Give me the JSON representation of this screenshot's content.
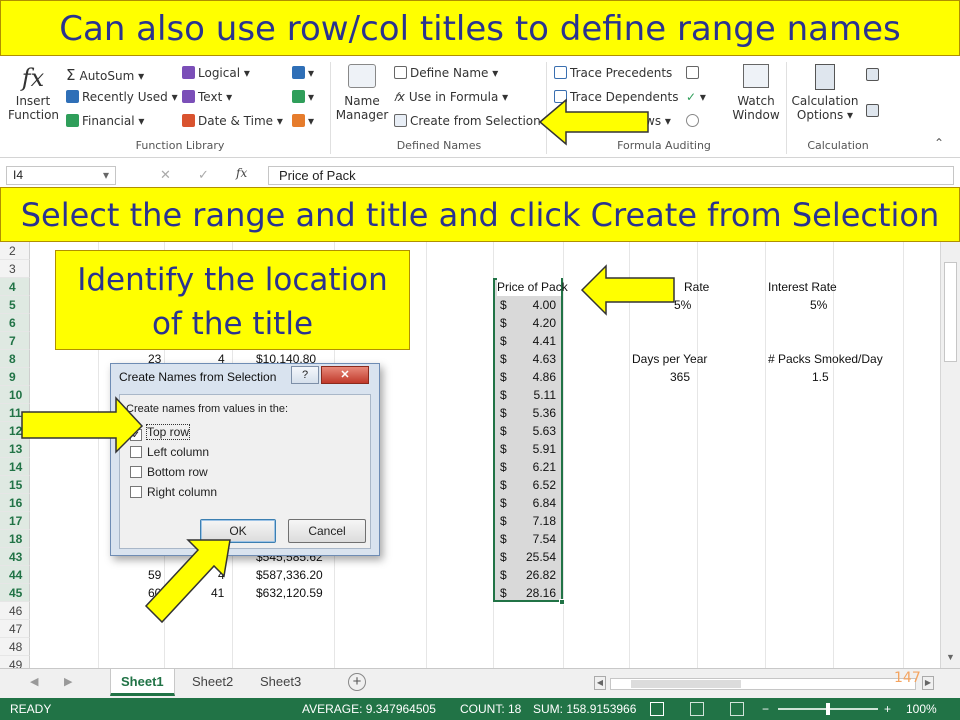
{
  "banners": {
    "top": "Can also use row/col titles to define range names",
    "middle": "Select the range and title and click Create from Selection",
    "callout": [
      "Identify the location",
      "of the title"
    ]
  },
  "ribbon": {
    "insert_function": [
      "Insert",
      "Function"
    ],
    "autosum": "AutoSum",
    "recently_used": "Recently Used",
    "financial": "Financial",
    "logical": "Logical",
    "text": "Text",
    "date_time": "Date & Time",
    "name_manager": [
      "Name",
      "Manager"
    ],
    "define_name": "Define Name",
    "use_in_formula": "Use in Formula",
    "create_from_selection": "Create from Selection",
    "trace_precedents": "Trace Precedents",
    "trace_dependents": "Trace Dependents",
    "remove_arrows_partial": "ws",
    "watch_window": [
      "Watch",
      "Window"
    ],
    "calculation_options": [
      "Calculation",
      "Options"
    ],
    "groups": [
      "Function Library",
      "Defined Names",
      "Formula Auditing",
      "Calculation"
    ]
  },
  "formula_bar": {
    "name_box": "I4",
    "fx": "fx",
    "content": "Price of Pack"
  },
  "grid": {
    "rows": [
      {
        "n": "2"
      },
      {
        "n": "3"
      },
      {
        "n": "4",
        "sel": true
      },
      {
        "n": "5",
        "sel": true
      },
      {
        "n": "6",
        "sel": true
      },
      {
        "n": "7",
        "sel": true
      },
      {
        "n": "8",
        "sel": true
      },
      {
        "n": "9",
        "sel": true
      },
      {
        "n": "10",
        "sel": true
      },
      {
        "n": "11",
        "sel": true
      },
      {
        "n": "12",
        "sel": true
      },
      {
        "n": "13",
        "sel": true
      },
      {
        "n": "14",
        "sel": true
      },
      {
        "n": "15",
        "sel": true
      },
      {
        "n": "16",
        "sel": true
      },
      {
        "n": "17",
        "sel": true
      },
      {
        "n": "18",
        "sel": true
      },
      {
        "n": "43",
        "sel": true
      },
      {
        "n": "44",
        "sel": true
      },
      {
        "n": "45",
        "sel": true
      },
      {
        "n": "46"
      },
      {
        "n": "47"
      },
      {
        "n": "48"
      },
      {
        "n": "49"
      }
    ],
    "price_header": "Price of Pack",
    "prices": [
      "4.00",
      "4.20",
      "4.41",
      "4.63",
      "4.86",
      "5.11",
      "5.36",
      "5.63",
      "5.91",
      "6.21",
      "6.52",
      "6.84",
      "7.18",
      "7.54",
      "25.54",
      "26.82",
      "28.16"
    ],
    "currency": "$",
    "rate_partial": "Rate",
    "rate_value": "5%",
    "interest_rate_label": "Interest Rate",
    "interest_rate_value": "5%",
    "days_per_year_label": "Days per Year",
    "days_per_year_value": "365",
    "packs_label": "# Packs Smoked/Day",
    "packs_value": "1.5",
    "row8": [
      "23",
      "4",
      "$10,140.80"
    ],
    "row43_partial": "$545,585.62",
    "row44": [
      "59",
      "4",
      "$587,336.20"
    ],
    "row45": [
      "60",
      "41",
      "$632,120.59"
    ]
  },
  "dialog": {
    "title": "Create Names from Selection",
    "help": "?",
    "close": "✕",
    "prompt": "Create names from values in the:",
    "options": [
      {
        "label": "Top row",
        "checked": true
      },
      {
        "label": "Left column",
        "checked": false
      },
      {
        "label": "Bottom row",
        "checked": false
      },
      {
        "label": "Right column",
        "checked": false
      }
    ],
    "ok": "OK",
    "cancel": "Cancel"
  },
  "sheets": [
    "Sheet1",
    "Sheet2",
    "Sheet3"
  ],
  "slide_number": "147",
  "status": {
    "ready": "READY",
    "average": "AVERAGE: 9.347964505",
    "count": "COUNT: 18",
    "sum": "SUM: 158.9153966",
    "zoom": "100%"
  },
  "colors": {
    "banner": "#ffff00",
    "banner_text": "#2a3390",
    "excel_green": "#217346"
  }
}
